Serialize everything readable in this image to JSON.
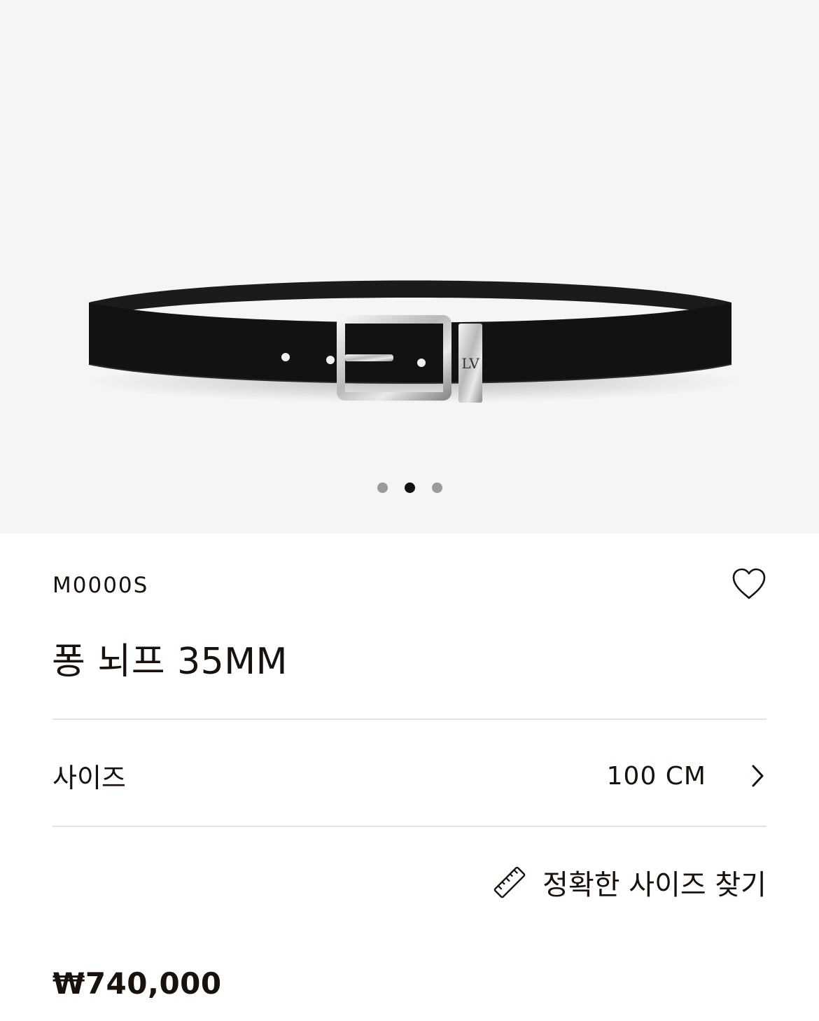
{
  "product": {
    "sku": "M0000S",
    "title": "퐁 뇌프 35MM",
    "price": "₩740,000",
    "logo_text": "LV"
  },
  "gallery": {
    "image_count": 3,
    "active_index": 1
  },
  "size": {
    "label": "사이즈",
    "value": "100 CM"
  },
  "size_guide": {
    "label": "정확한 사이즈 찾기"
  },
  "colors": {
    "gallery_bg": "#f6f5f3",
    "text": "#19110b",
    "divider": "#e5e3e0",
    "dot_inactive": "#9a9a9a",
    "dot_active": "#111111"
  },
  "icons": [
    "heart-icon",
    "chevron-right-icon",
    "ruler-icon"
  ]
}
